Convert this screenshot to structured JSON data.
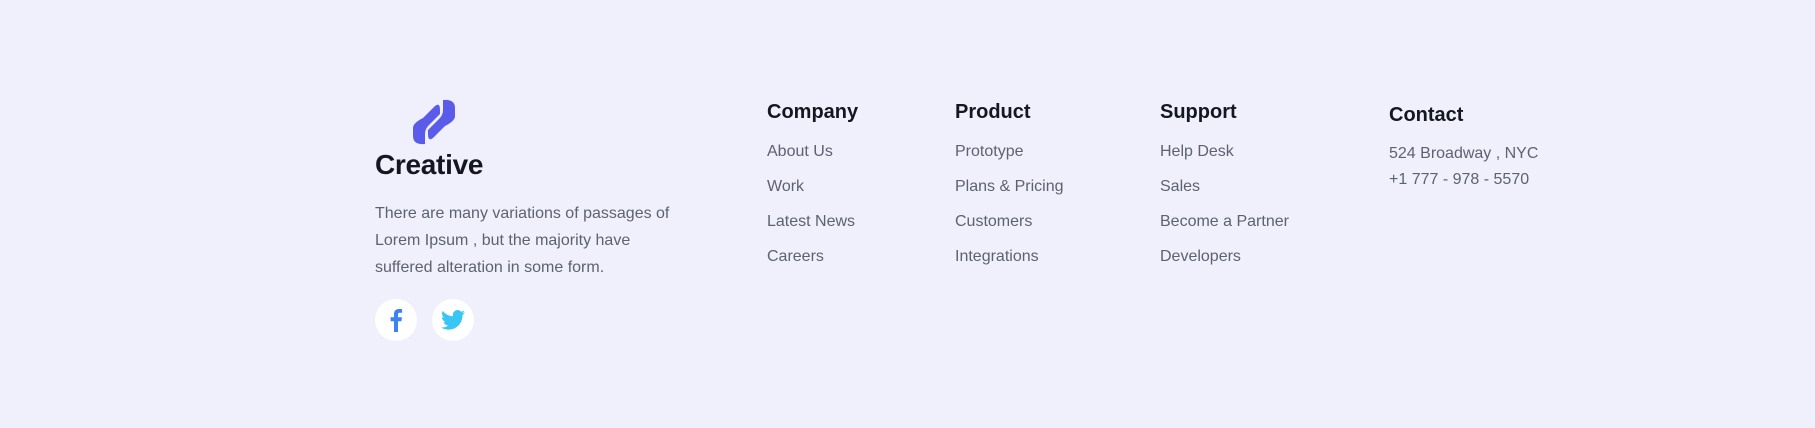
{
  "brand": {
    "name": "Creative",
    "description": "There are many variations of passages of Lorem Ipsum , but the majority have suffered alteration in some form.",
    "logo_color": "#5b5bea"
  },
  "socials": [
    {
      "icon": "facebook-icon",
      "color": "#3b82f6"
    },
    {
      "icon": "twitter-icon",
      "color": "#38c6f4"
    }
  ],
  "columns": {
    "company": {
      "title": "Company",
      "links": [
        "About Us",
        "Work",
        "Latest News",
        "Careers"
      ]
    },
    "product": {
      "title": "Product",
      "links": [
        "Prototype",
        "Plans & Pricing",
        "Customers",
        "Integrations"
      ]
    },
    "support": {
      "title": "Support",
      "links": [
        "Help Desk",
        "Sales",
        "Become a Partner",
        "Developers"
      ]
    },
    "contact": {
      "title": "Contact",
      "address": "524 Broadway , NYC",
      "phone": "+1 777 - 978 - 5570"
    }
  }
}
